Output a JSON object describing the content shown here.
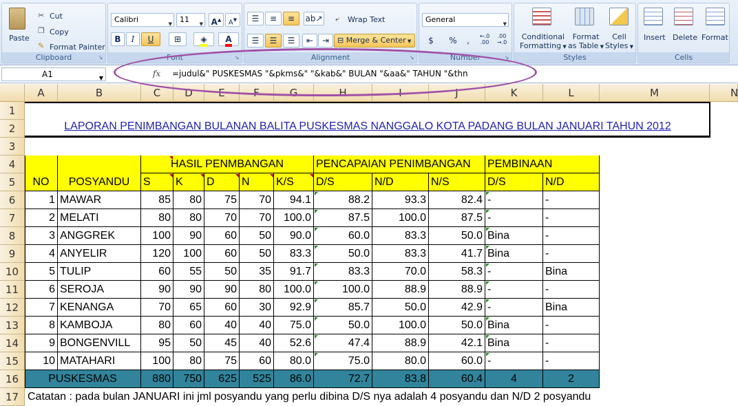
{
  "ribbon": {
    "clipboard": {
      "paste": "Paste",
      "cut": "Cut",
      "copy": "Copy",
      "painter": "Format Painter",
      "label": "Clipboard"
    },
    "font": {
      "name": "Calibri",
      "size": "11",
      "bold": "B",
      "italic": "I",
      "underline": "U",
      "grow": "A",
      "shrink": "A",
      "label": "Font"
    },
    "alignment": {
      "wrap": "Wrap Text",
      "merge": "Merge & Center",
      "label": "Alignment"
    },
    "number": {
      "format": "General",
      "currency": "$",
      "percent": "%",
      "comma": ",",
      "inc": "←.0 .00",
      "dec": ".00 →.0",
      "label": "Number"
    },
    "styles": {
      "cond": "Conditional",
      "cond2": "Formatting",
      "table": "Format",
      "table2": "as Table",
      "cell": "Cell",
      "cell2": "Styles",
      "label": "Styles"
    },
    "cells": {
      "insert": "Insert",
      "delete": "Delete",
      "format": "Format",
      "label": "Cells"
    }
  },
  "formula_bar": {
    "name_box": "A1",
    "fx": "fx",
    "formula": "=judul&\" PUSKESMAS \"&pkms&\" \"&kab&\" BULAN \"&aa&\" TAHUN \"&thn"
  },
  "columns": [
    "A",
    "B",
    "C",
    "D",
    "E",
    "F",
    "G",
    "H",
    "I",
    "J",
    "K",
    "L",
    "M",
    "N"
  ],
  "rows": [
    "1",
    "2",
    "3",
    "4",
    "5",
    "6",
    "7",
    "8",
    "9",
    "10",
    "11",
    "12",
    "13",
    "14",
    "15",
    "16",
    "17"
  ],
  "sheet": {
    "title": "LAPORAN PENIMBANGAN BULANAN BALITA PUSKESMAS NANGGALO KOTA PADANG BULAN JANUARI TAHUN 2012",
    "group_hasil": "HASIL PENMBANGAN",
    "group_pencapaian": "PENCAPAIAN PENIMBANGAN",
    "group_pembinaan": "PEMBINAAN",
    "headers": [
      "NO",
      "POSYANDU",
      "S",
      "K",
      "D",
      "N",
      "K/S",
      "D/S",
      "N/D",
      "N/S",
      "D/S",
      "N/D"
    ],
    "data": [
      [
        "1",
        "MAWAR",
        "85",
        "80",
        "75",
        "70",
        "94.1",
        "88.2",
        "93.3",
        "82.4",
        "-",
        "-"
      ],
      [
        "2",
        "MELATI",
        "80",
        "80",
        "70",
        "70",
        "100.0",
        "87.5",
        "100.0",
        "87.5",
        "-",
        "-"
      ],
      [
        "3",
        "ANGGREK",
        "100",
        "90",
        "60",
        "50",
        "90.0",
        "60.0",
        "83.3",
        "50.0",
        "Bina",
        "-"
      ],
      [
        "4",
        "ANYELIR",
        "120",
        "100",
        "60",
        "50",
        "83.3",
        "50.0",
        "83.3",
        "41.7",
        "Bina",
        "-"
      ],
      [
        "5",
        "TULIP",
        "60",
        "55",
        "50",
        "35",
        "91.7",
        "83.3",
        "70.0",
        "58.3",
        "-",
        "Bina"
      ],
      [
        "6",
        "SEROJA",
        "90",
        "90",
        "90",
        "80",
        "100.0",
        "100.0",
        "88.9",
        "88.9",
        "-",
        "-"
      ],
      [
        "7",
        "KENANGA",
        "70",
        "65",
        "60",
        "30",
        "92.9",
        "85.7",
        "50.0",
        "42.9",
        "-",
        "Bina"
      ],
      [
        "8",
        "KAMBOJA",
        "80",
        "60",
        "40",
        "40",
        "75.0",
        "50.0",
        "100.0",
        "50.0",
        "Bina",
        "-"
      ],
      [
        "9",
        "BONGENVILL",
        "95",
        "50",
        "45",
        "40",
        "52.6",
        "47.4",
        "88.9",
        "42.1",
        "Bina",
        "-"
      ],
      [
        "10",
        "MATAHARI",
        "100",
        "80",
        "75",
        "60",
        "80.0",
        "75.0",
        "80.0",
        "60.0",
        "-",
        "-"
      ]
    ],
    "total": [
      "PUSKESMAS",
      "880",
      "750",
      "625",
      "525",
      "86.0",
      "72.7",
      "83.8",
      "60.4",
      "4",
      "2"
    ],
    "note": "Catatan : pada bulan JANUARI ini jml posyandu yang perlu dibina D/S nya adalah 4 posyandu dan N/D 2 posyandu"
  }
}
